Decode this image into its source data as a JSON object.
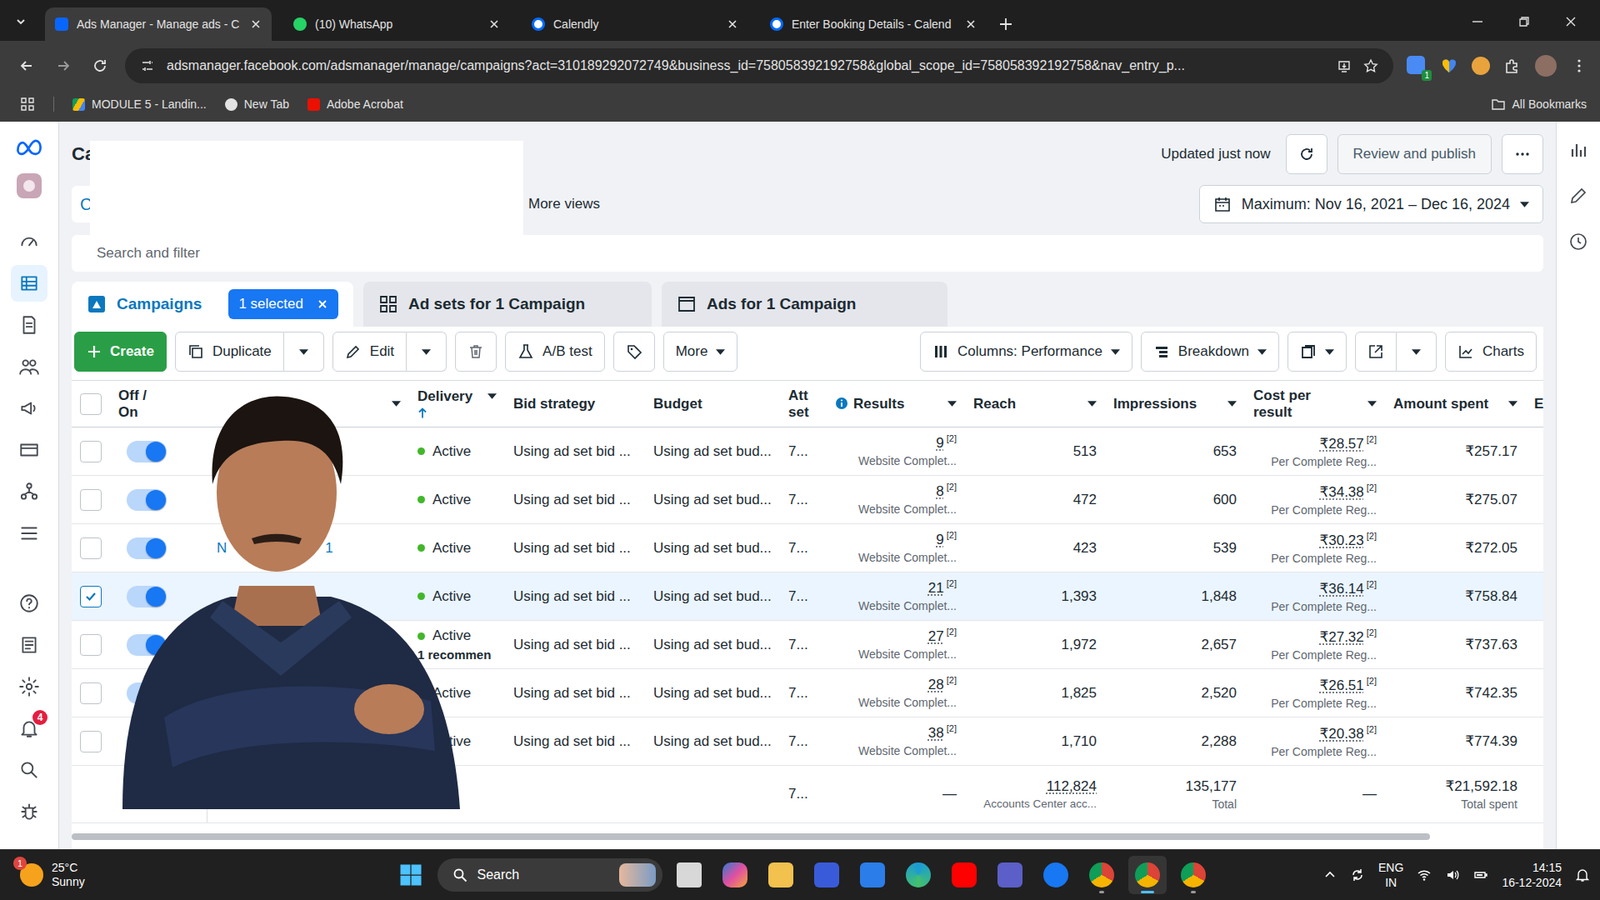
{
  "browser": {
    "tabs": [
      {
        "title": "Ads Manager - Manage ads - C",
        "selected": true
      },
      {
        "title": "(10) WhatsApp",
        "selected": false
      },
      {
        "title": "Calendly",
        "selected": false
      },
      {
        "title": "Enter Booking Details - Calend",
        "selected": false
      }
    ],
    "url": "adsmanager.facebook.com/adsmanager/manage/campaigns?act=310189292072749&business_id=758058392192758&global_scope_id=758058392192758&nav_entry_p...",
    "extension_badge": "1",
    "bookmarks": [
      "MODULE 5 - Landin...",
      "New Tab",
      "Adobe Acrobat"
    ],
    "all_bookmarks": "All Bookmarks"
  },
  "sidebar": {
    "items": [
      {
        "selected": false
      },
      {
        "selected": true
      },
      {
        "selected": false
      },
      {
        "selected": false
      },
      {
        "selected": false
      },
      {
        "selected": false
      },
      {
        "selected": false
      },
      {
        "selected": false
      },
      {
        "selected": false
      },
      {
        "selected": false
      },
      {
        "selected": false
      },
      {
        "selected": false,
        "badge": "4"
      },
      {
        "selected": false
      },
      {
        "selected": false
      }
    ]
  },
  "header": {
    "title": "Ca",
    "view": "C",
    "more_views": "More views",
    "updated": "Updated just now",
    "review": "Review and publish",
    "date_range": "Maximum: Nov 16, 2021 – Dec 16, 2024"
  },
  "search": {
    "placeholder": "Search and filter"
  },
  "level_tabs": [
    {
      "label": "Campaigns",
      "selected": true
    },
    {
      "label": "Ad sets for 1 Campaign",
      "selected": false
    },
    {
      "label": "Ads for 1 Campaign",
      "selected": false
    }
  ],
  "selection": {
    "label": "1 selected"
  },
  "toolbar": {
    "create": "Create",
    "duplicate": "Duplicate",
    "edit": "Edit",
    "ab_test": "A/B test",
    "more": "More",
    "columns": "Columns: Performance",
    "breakdown": "Breakdown",
    "charts": "Charts"
  },
  "table": {
    "header_checkbox": {
      "checked": false
    },
    "columns": [
      {
        "label": "Off / On",
        "sorted": false
      },
      {
        "label": "Delivery",
        "sorted": true
      },
      {
        "label": "Bid strategy",
        "sorted": false
      },
      {
        "label": "Budget",
        "sorted": false
      },
      {
        "label": "Att set",
        "sorted": false
      },
      {
        "label": "Results",
        "sorted": false
      },
      {
        "label": "Reach",
        "sorted": false
      },
      {
        "label": "Impressions",
        "sorted": false
      },
      {
        "label": "Cost per result",
        "sorted": false
      },
      {
        "label": "Amount spent",
        "sorted": false
      },
      {
        "label": "E",
        "sorted": false
      }
    ],
    "rows": [
      {
        "on": true,
        "checked": false,
        "name_fragments": [],
        "delivery": "Active",
        "bid": "Using ad set bid ...",
        "budget": "Using ad set bud...",
        "attribution": "7...",
        "results": "9",
        "results_ref": "[2]",
        "results_label": "Website Complet...",
        "reach": "513",
        "impressions": "653",
        "cost": "₹28.57",
        "cost_ref": "[2]",
        "cost_label": "Per Complete Reg...",
        "amount": "₹257.17"
      },
      {
        "on": true,
        "checked": false,
        "name_fragments": [],
        "delivery": "Active",
        "bid": "Using ad set bid ...",
        "budget": "Using ad set bud...",
        "attribution": "7...",
        "results": "8",
        "results_ref": "[2]",
        "results_label": "Website Complet...",
        "reach": "472",
        "impressions": "600",
        "cost": "₹34.38",
        "cost_ref": "[2]",
        "cost_label": "Per Complete Reg...",
        "amount": "₹275.07"
      },
      {
        "on": true,
        "checked": false,
        "name_fragments": [
          "N",
          "1"
        ],
        "delivery": "Active",
        "bid": "Using ad set bid ...",
        "budget": "Using ad set bud...",
        "attribution": "7...",
        "results": "9",
        "results_ref": "[2]",
        "results_label": "Website Complet...",
        "reach": "423",
        "impressions": "539",
        "cost": "₹30.23",
        "cost_ref": "[2]",
        "cost_label": "Per Complete Reg...",
        "amount": "₹272.05"
      },
      {
        "on": true,
        "checked": true,
        "name_fragments": [],
        "delivery": "Active",
        "bid": "Using ad set bid ...",
        "budget": "Using ad set bud...",
        "attribution": "7...",
        "results": "21",
        "results_ref": "[2]",
        "results_label": "Website Complet...",
        "reach": "1,393",
        "impressions": "1,848",
        "cost": "₹36.14",
        "cost_ref": "[2]",
        "cost_label": "Per Complete Reg...",
        "amount": "₹758.84"
      },
      {
        "on": true,
        "checked": false,
        "name_fragments": [],
        "delivery": "Active",
        "note": "1 recommen",
        "bid": "Using ad set bid ...",
        "budget": "Using ad set bud...",
        "attribution": "7...",
        "results": "27",
        "results_ref": "[2]",
        "results_label": "Website Complet...",
        "reach": "1,972",
        "impressions": "2,657",
        "cost": "₹27.32",
        "cost_ref": "[2]",
        "cost_label": "Per Complete Reg...",
        "amount": "₹737.63"
      },
      {
        "on": true,
        "checked": false,
        "name_fragments": [],
        "delivery": "Active",
        "bid": "Using ad set bid ...",
        "budget": "Using ad set bud...",
        "attribution": "7...",
        "results": "28",
        "results_ref": "[2]",
        "results_label": "Website Complet...",
        "reach": "1,825",
        "impressions": "2,520",
        "cost": "₹26.51",
        "cost_ref": "[2]",
        "cost_label": "Per Complete Reg...",
        "amount": "₹742.35"
      },
      {
        "on": true,
        "checked": false,
        "name_fragments": [],
        "delivery": "Active",
        "bid": "Using ad set bid ...",
        "budget": "Using ad set bud...",
        "attribution": "7...",
        "results": "38",
        "results_ref": "[2]",
        "results_label": "Website Complet...",
        "reach": "1,710",
        "impressions": "2,288",
        "cost": "₹20.38",
        "cost_ref": "[2]",
        "cost_label": "Per Complete Reg...",
        "amount": "₹774.39"
      }
    ],
    "totals": {
      "attribution": "7...",
      "results": "—",
      "reach": "112,824",
      "reach_label": "Accounts Center acc...",
      "impressions": "135,177",
      "impressions_label": "Total",
      "cost": "—",
      "amount": "₹21,592.18",
      "amount_label": "Total spent"
    }
  },
  "taskbar": {
    "weather": {
      "temp": "25°C",
      "condition": "Sunny",
      "badge": "1"
    },
    "search": "Search",
    "apps": [
      {
        "running": false,
        "selected": false
      },
      {
        "running": false,
        "selected": false
      },
      {
        "running": false,
        "selected": false
      },
      {
        "running": false,
        "selected": false
      },
      {
        "running": false,
        "selected": false
      },
      {
        "running": false,
        "selected": false
      },
      {
        "running": false,
        "selected": false
      },
      {
        "running": false,
        "selected": false
      },
      {
        "running": false,
        "selected": false
      },
      {
        "running": true,
        "selected": false
      },
      {
        "running": true,
        "selected": true
      },
      {
        "running": true,
        "selected": false
      }
    ],
    "language": "ENG",
    "region": "IN",
    "time": "14:15",
    "date": "16-12-2024"
  }
}
